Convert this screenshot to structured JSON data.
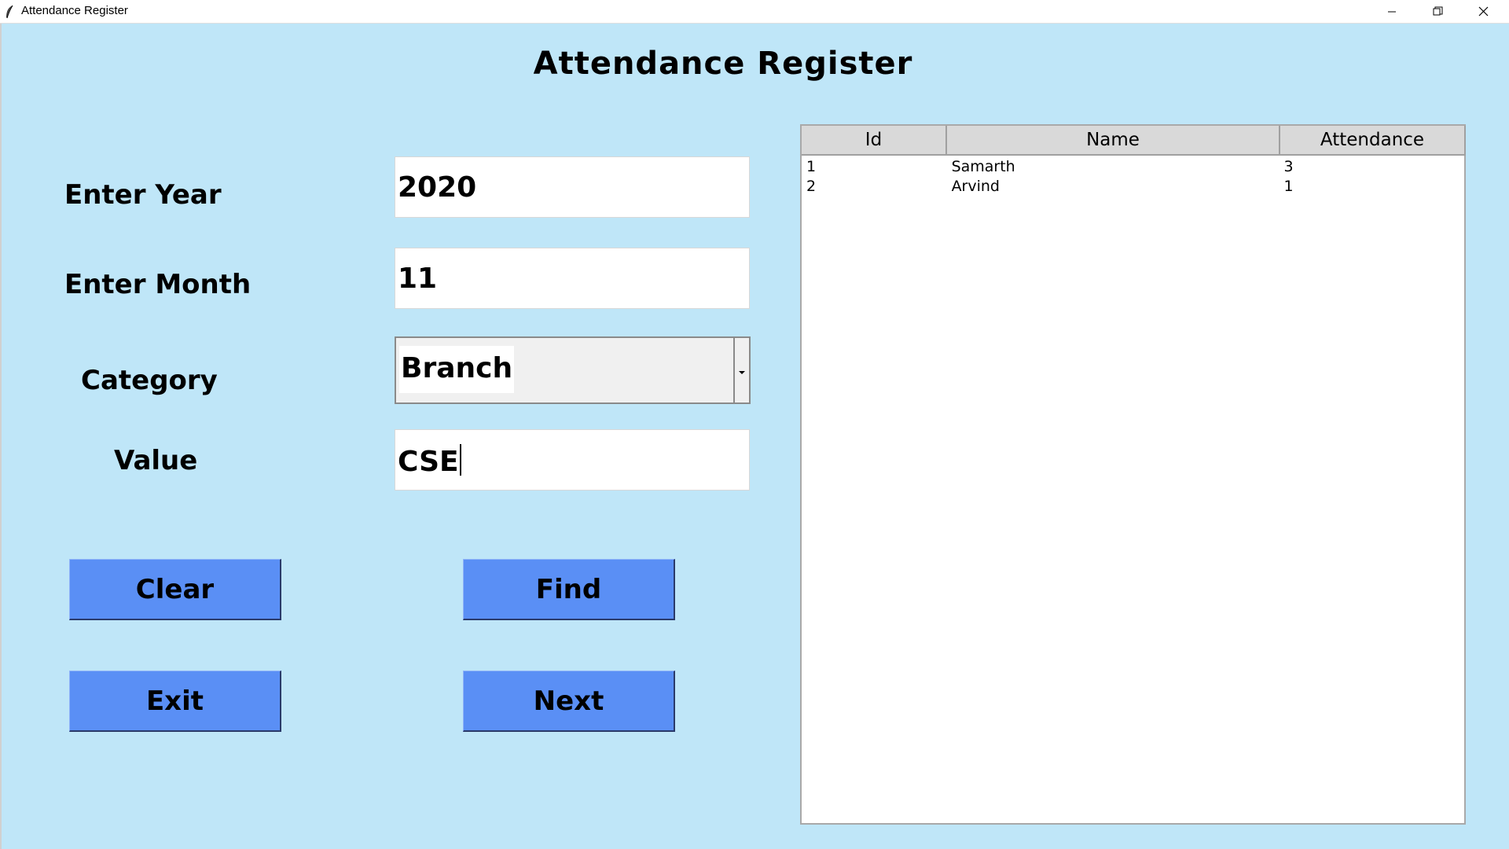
{
  "window": {
    "title": "Attendance Register",
    "controls": {
      "minimize_icon": "minimize-icon",
      "maximize_icon": "restore-icon",
      "close_icon": "close-icon"
    }
  },
  "form": {
    "heading": "Attendance Register",
    "year": {
      "label": "Enter Year",
      "value": "2020"
    },
    "month": {
      "label": "Enter Month",
      "value": "11"
    },
    "category": {
      "label": "Category",
      "selected": "Branch"
    },
    "value": {
      "label": "Value",
      "value": "CSE"
    }
  },
  "buttons": {
    "clear": "Clear",
    "find": "Find",
    "exit": "Exit",
    "next": "Next"
  },
  "table": {
    "columns": [
      "Id",
      "Name",
      "Attendance"
    ],
    "rows": [
      [
        "1",
        "Samarth",
        "3"
      ],
      [
        "2",
        "Arvind",
        "1"
      ]
    ]
  },
  "colors": {
    "background": "#bfe6f8",
    "button": "#5a8ff5",
    "table_header": "#d9d9d9"
  }
}
